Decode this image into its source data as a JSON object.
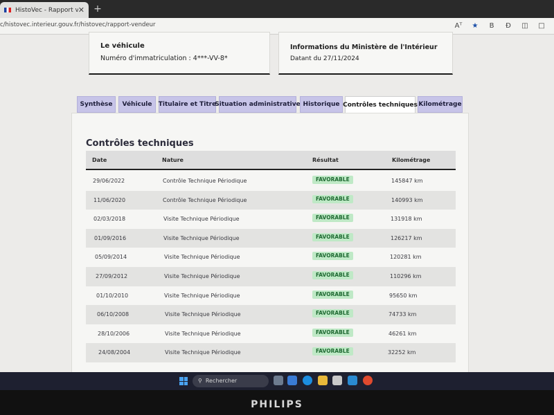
{
  "browser": {
    "tab_title": "HistoVec - Rapport vendeur",
    "tab_close": "✕",
    "new_tab": "+",
    "url": "c/histovec.interieur.gouv.fr/histovec/rapport-vendeur",
    "toolbar_icons": [
      "Aᵀ",
      "★",
      "B",
      "Ɖ",
      "◫",
      "□"
    ]
  },
  "vehicle_card": {
    "title": "Le véhicule",
    "plate_label": "Numéro d'immatriculation : 4***-VV-8*"
  },
  "ministry_card": {
    "title": "Informations du Ministère de l'Intérieur",
    "date_text": "Datant du 27/11/2024"
  },
  "tabs": [
    {
      "label": "Synthèse",
      "active": false
    },
    {
      "label": "Véhicule",
      "active": false
    },
    {
      "label": "Titulaire et Titre",
      "active": false
    },
    {
      "label": "Situation administrative",
      "active": false
    },
    {
      "label": "Historique",
      "active": false
    },
    {
      "label": "Contrôles techniques",
      "active": true
    },
    {
      "label": "Kilométrage",
      "active": false
    }
  ],
  "controles": {
    "title": "Contrôles techniques",
    "columns": [
      "Date",
      "Nature",
      "Résultat",
      "Kilométrage"
    ],
    "rows": [
      {
        "date": "29/06/2022",
        "nature": "Contrôle Technique Périodique",
        "resultat": "FAVORABLE",
        "km": "145847 km"
      },
      {
        "date": "11/06/2020",
        "nature": "Contrôle Technique Périodique",
        "resultat": "FAVORABLE",
        "km": "140993 km"
      },
      {
        "date": "02/03/2018",
        "nature": "Visite Technique Périodique",
        "resultat": "FAVORABLE",
        "km": "131918 km"
      },
      {
        "date": "01/09/2016",
        "nature": "Visite Technique Périodique",
        "resultat": "FAVORABLE",
        "km": "126217 km"
      },
      {
        "date": "05/09/2014",
        "nature": "Visite Technique Périodique",
        "resultat": "FAVORABLE",
        "km": "120281 km"
      },
      {
        "date": "27/09/2012",
        "nature": "Visite Technique Périodique",
        "resultat": "FAVORABLE",
        "km": "110296 km"
      },
      {
        "date": "01/10/2010",
        "nature": "Visite Technique Périodique",
        "resultat": "FAVORABLE",
        "km": "95650 km"
      },
      {
        "date": "06/10/2008",
        "nature": "Visite Technique Périodique",
        "resultat": "FAVORABLE",
        "km": "74733 km"
      },
      {
        "date": "28/10/2006",
        "nature": "Visite Technique Périodique",
        "resultat": "FAVORABLE",
        "km": "46261 km"
      },
      {
        "date": "24/08/2004",
        "nature": "Visite Technique Périodique",
        "resultat": "FAVORABLE",
        "km": "32252 km"
      }
    ]
  },
  "taskbar": {
    "search_placeholder": "Rechercher",
    "search_icon": "⚲"
  },
  "monitor": {
    "brand": "PHILIPS"
  },
  "colors": {
    "tab_inactive": "#c7c4e8",
    "badge_bg": "#bfe9c6",
    "badge_text": "#1f6a32"
  }
}
